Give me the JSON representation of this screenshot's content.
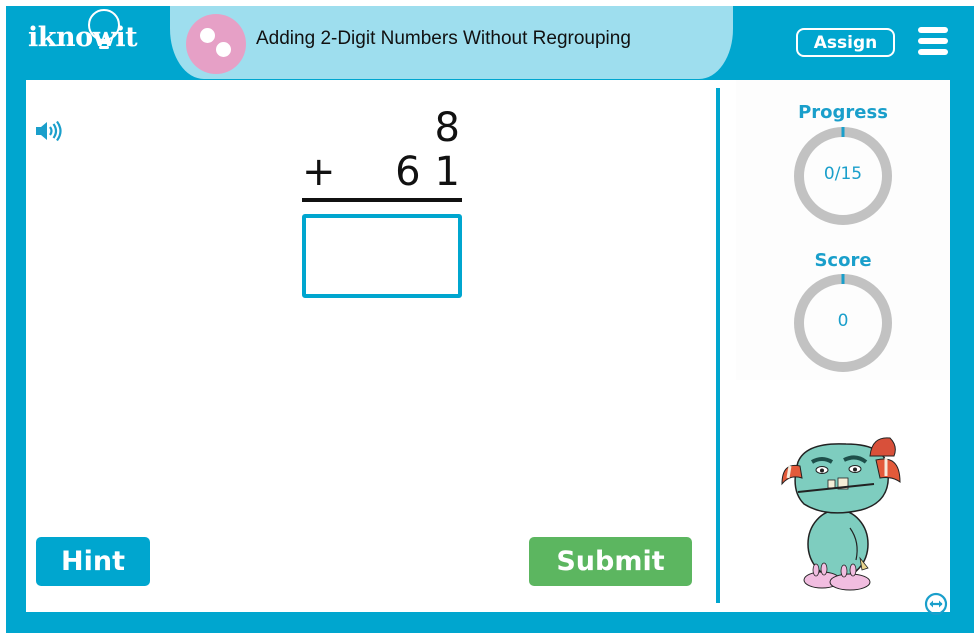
{
  "header": {
    "logo_text": "iknowit",
    "lesson_title": "Adding 2-Digit Numbers Without Regrouping",
    "topic_icon": "two-dots-icon",
    "assign_label": "Assign",
    "menu_icon": "hamburger-menu-icon"
  },
  "problem": {
    "addend_top": "8",
    "operator": "+",
    "addend_bottom": "61",
    "answer_value": "",
    "sound_icon": "speaker-icon"
  },
  "buttons": {
    "hint_label": "Hint",
    "submit_label": "Submit"
  },
  "stats": {
    "progress": {
      "label": "Progress",
      "value_text": "0/15",
      "completed": 0,
      "total": 15
    },
    "score": {
      "label": "Score",
      "value_text": "0",
      "value": 0
    }
  },
  "mascot": {
    "description": "teal monster with striped horns, red beanie and bunny slippers"
  },
  "footer": {
    "swap_icon": "left-right-arrow-icon"
  },
  "colors": {
    "frame": "#00a6cf",
    "title_pill": "#9edeee",
    "topic_icon": "#e6a0c6",
    "submit": "#5cb660",
    "ring_track": "#c2c2c2",
    "accent_text": "#1a9fcb"
  }
}
